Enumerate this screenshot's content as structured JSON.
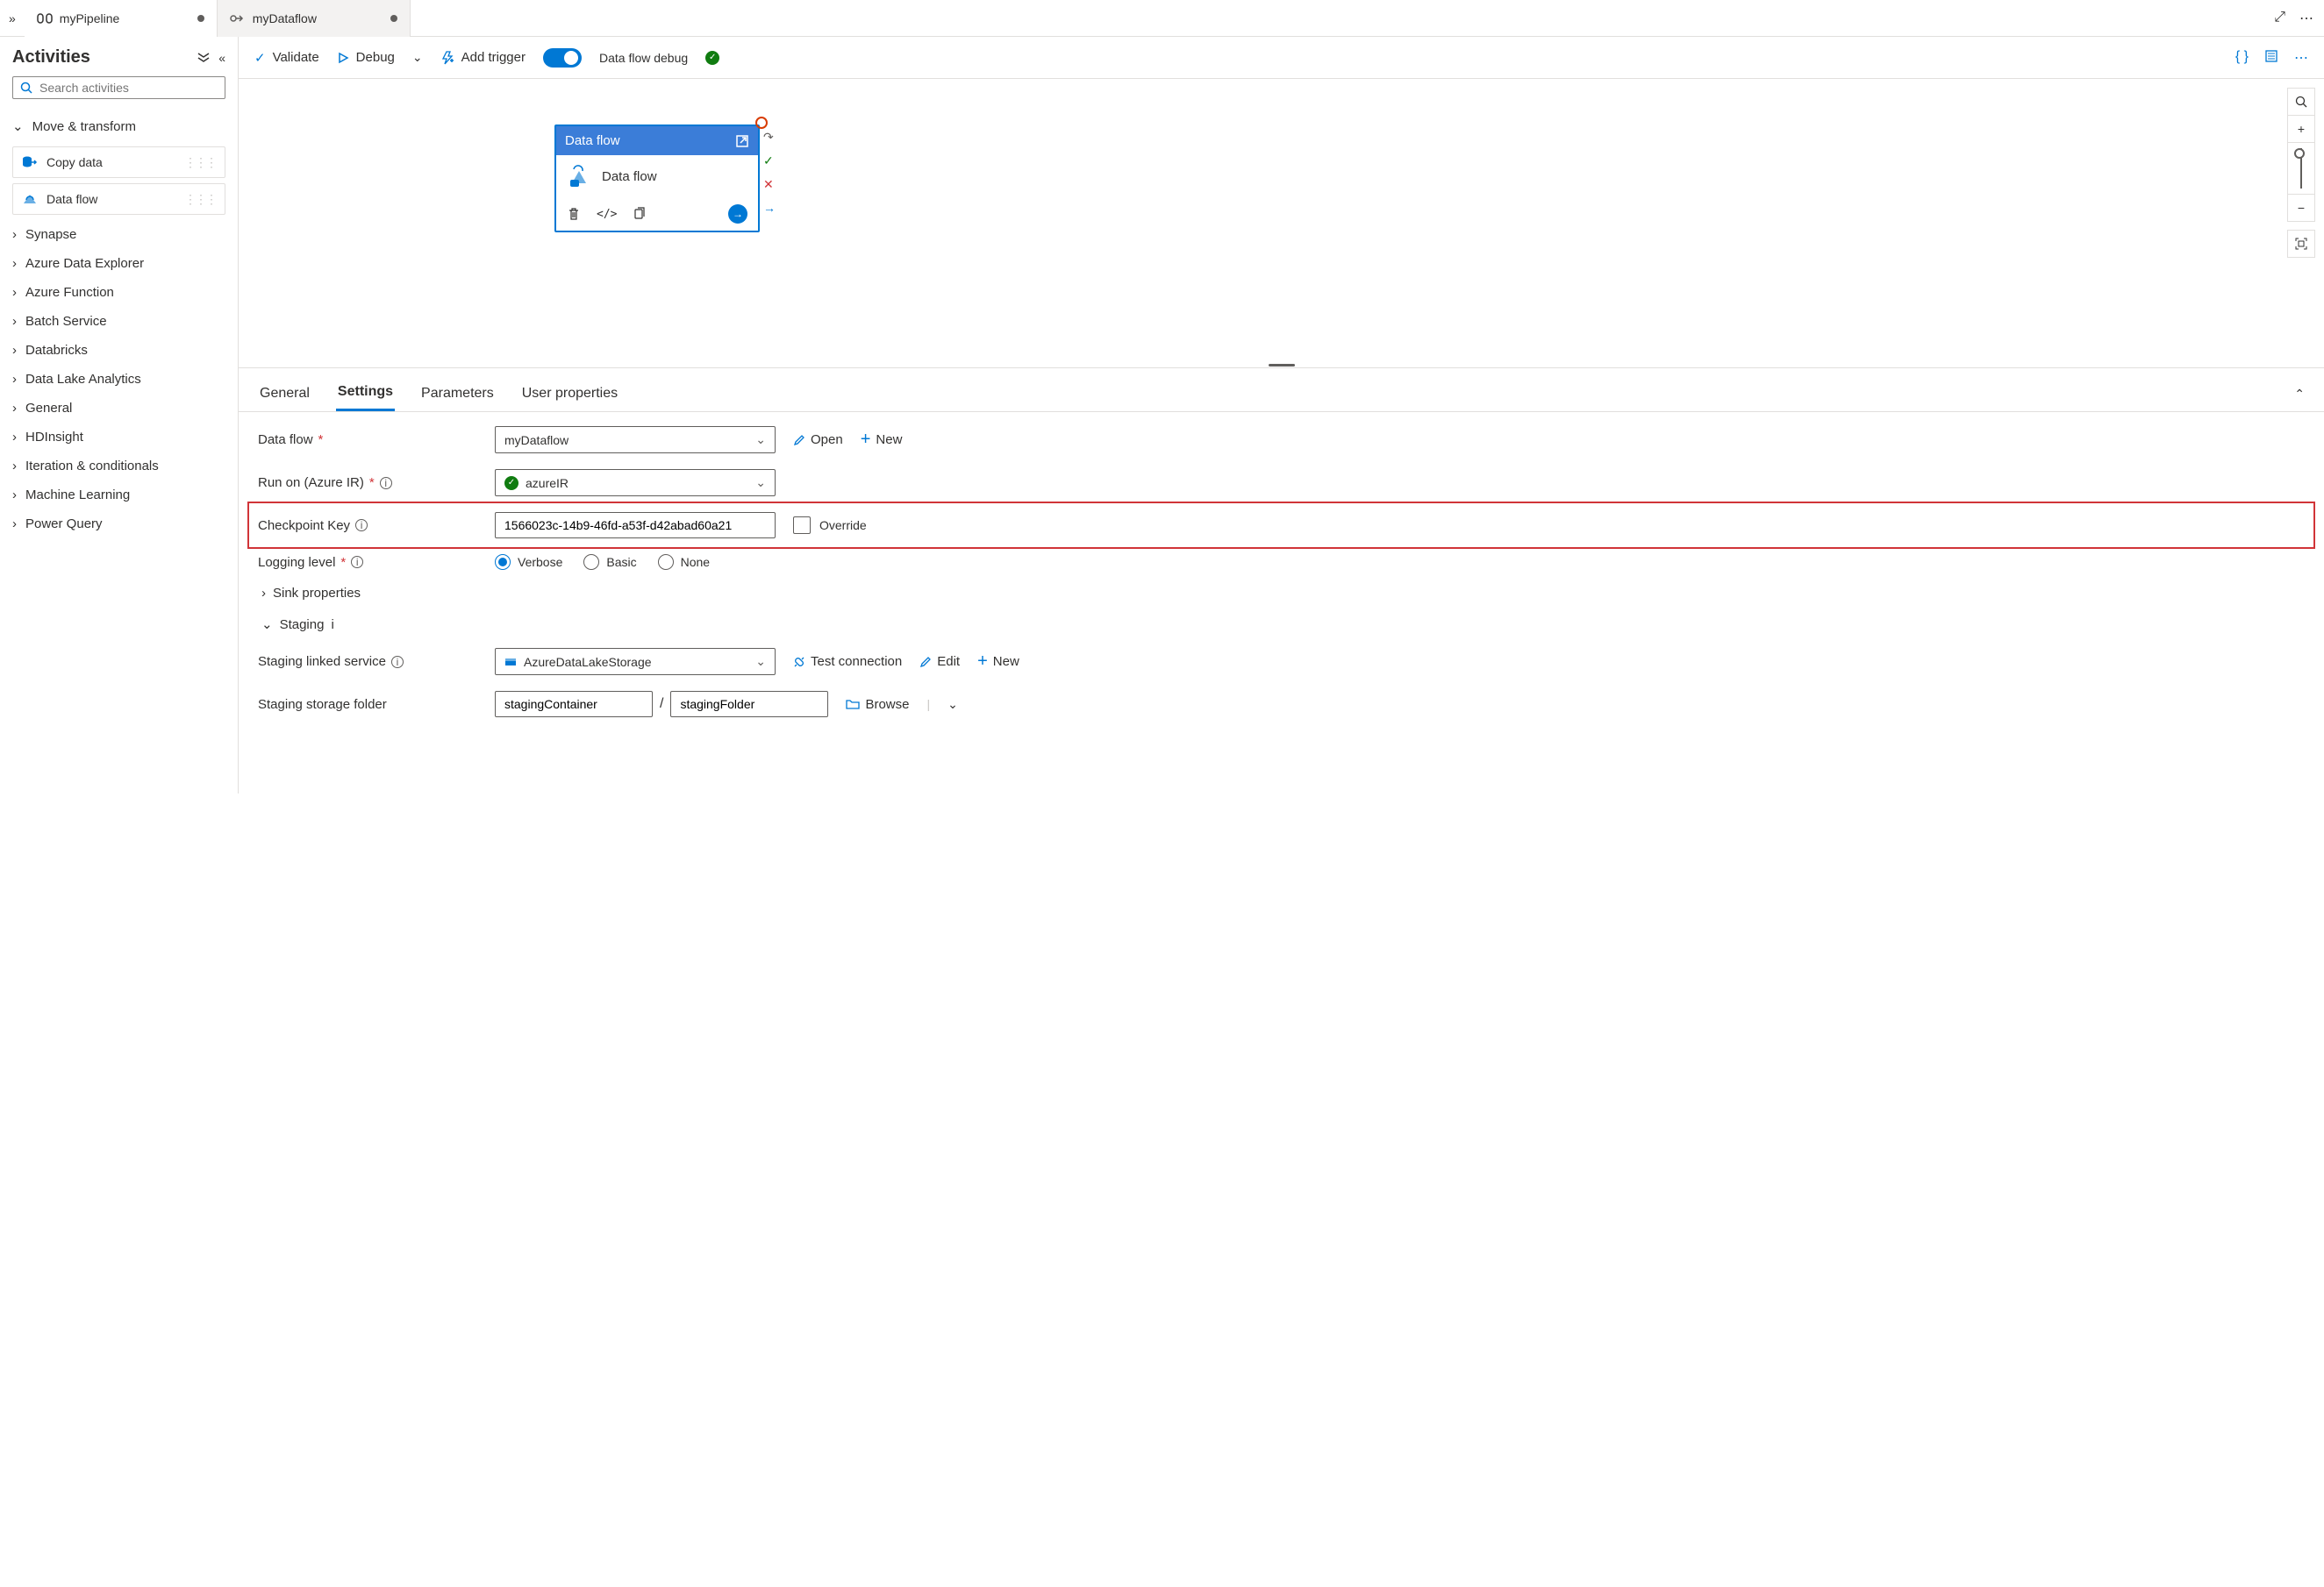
{
  "tabs": [
    {
      "title": "myPipeline",
      "dirty": true
    },
    {
      "title": "myDataflow",
      "dirty": true
    }
  ],
  "sidebar": {
    "title": "Activities",
    "search_placeholder": "Search activities",
    "expanded_category": "Move & transform",
    "activities": [
      {
        "label": "Copy data"
      },
      {
        "label": "Data flow"
      }
    ],
    "categories": [
      "Synapse",
      "Azure Data Explorer",
      "Azure Function",
      "Batch Service",
      "Databricks",
      "Data Lake Analytics",
      "General",
      "HDInsight",
      "Iteration & conditionals",
      "Machine Learning",
      "Power Query"
    ]
  },
  "toolbar": {
    "validate": "Validate",
    "debug": "Debug",
    "add_trigger": "Add trigger",
    "debug_toggle_label": "Data flow debug"
  },
  "node": {
    "header": "Data flow",
    "body": "Data flow"
  },
  "prop_tabs": [
    "General",
    "Settings",
    "Parameters",
    "User properties"
  ],
  "settings": {
    "dataflow_label": "Data flow",
    "dataflow_value": "myDataflow",
    "open": "Open",
    "new": "New",
    "runon_label": "Run on (Azure IR)",
    "runon_value": "azureIR",
    "checkpoint_label": "Checkpoint Key",
    "checkpoint_value": "1566023c-14b9-46fd-a53f-d42abad60a21",
    "override": "Override",
    "logging_label": "Logging level",
    "logging_options": [
      "Verbose",
      "Basic",
      "None"
    ],
    "sink_props": "Sink properties",
    "staging": "Staging",
    "staging_linked_label": "Staging linked service",
    "staging_linked_value": "AzureDataLakeStorage",
    "test_conn": "Test connection",
    "edit": "Edit",
    "staging_folder_label": "Staging storage folder",
    "staging_container": "stagingContainer",
    "staging_folder": "stagingFolder",
    "browse": "Browse"
  }
}
